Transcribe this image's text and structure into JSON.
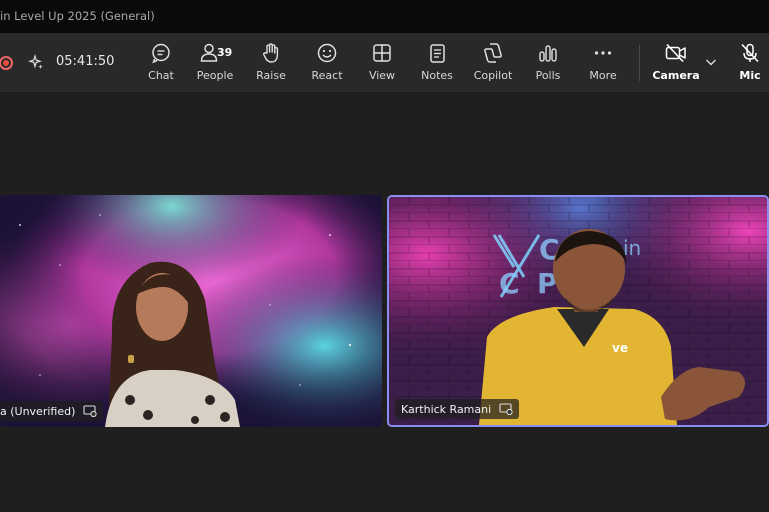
{
  "window": {
    "title": "in Level Up 2025 (General)"
  },
  "toolbar": {
    "timer": "05:41:50",
    "chat_label": "Chat",
    "people_label": "People",
    "people_count": "39",
    "raise_label": "Raise",
    "react_label": "React",
    "view_label": "View",
    "notes_label": "Notes",
    "copilot_label": "Copilot",
    "polls_label": "Polls",
    "more_label": "More",
    "camera_label": "Camera",
    "mic_label": "Mic"
  },
  "participants": [
    {
      "name": "a (Unverified)"
    },
    {
      "name": "Karthick Ramani"
    }
  ],
  "colors": {
    "active_speaker_border": "#8a8ef0",
    "recording": "#e74c3c"
  }
}
